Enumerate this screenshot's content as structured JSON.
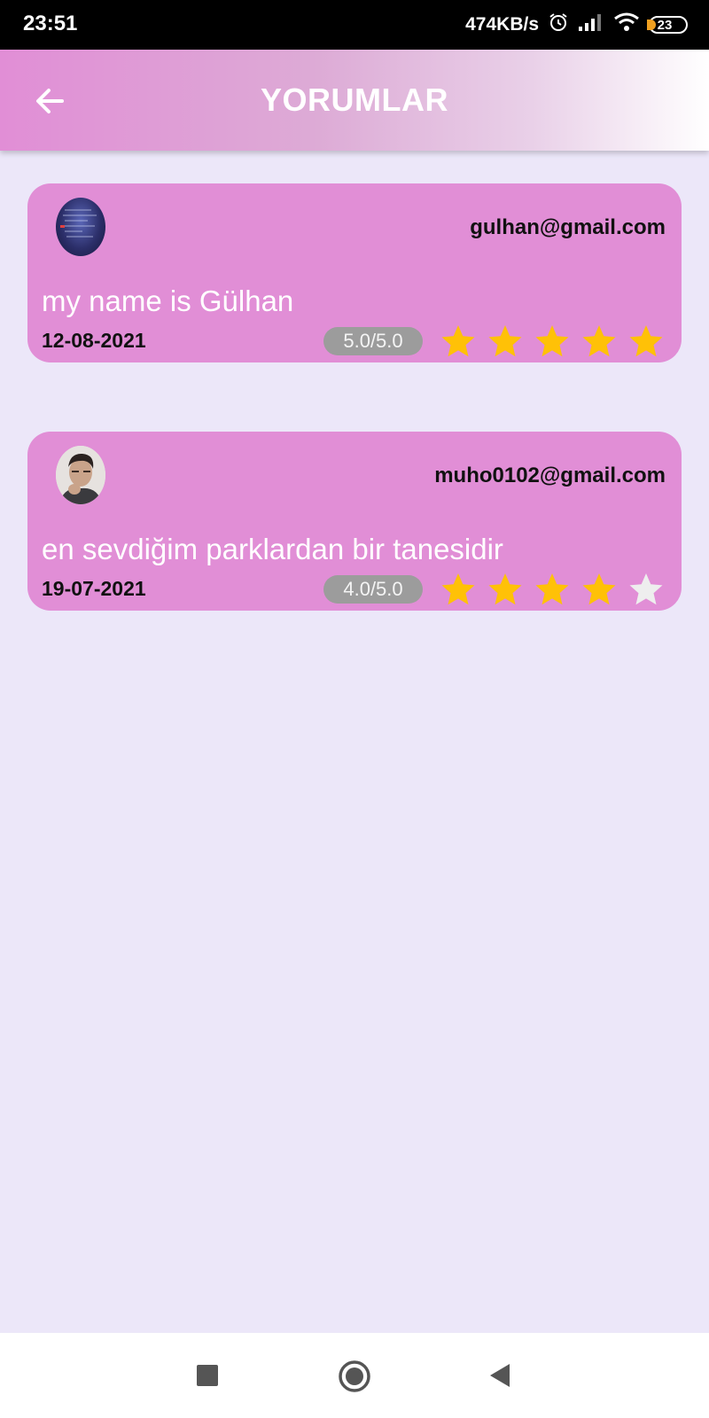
{
  "status_bar": {
    "time": "23:51",
    "speed": "474KB/s",
    "battery": "23"
  },
  "header": {
    "title": "YORUMLAR",
    "back_icon": "arrow-left-icon"
  },
  "reviews": [
    {
      "email": "gulhan@gmail.com",
      "comment": "my name is Gülhan",
      "date": "12-08-2021",
      "rating_text": "5.0/5.0",
      "rating": 5
    },
    {
      "email": "muho0102@gmail.com",
      "comment": "en sevdiğim parklardan bir tanesidir",
      "date": "19-07-2021",
      "rating_text": "4.0/5.0",
      "rating": 4
    }
  ],
  "colors": {
    "card": "#e18ed6",
    "background": "#ece7f9",
    "star_filled": "#ffc107",
    "star_empty": "#eeeeee"
  },
  "nav": {
    "recent_icon": "square-icon",
    "home_icon": "circle-icon",
    "back_icon": "triangle-back-icon"
  }
}
